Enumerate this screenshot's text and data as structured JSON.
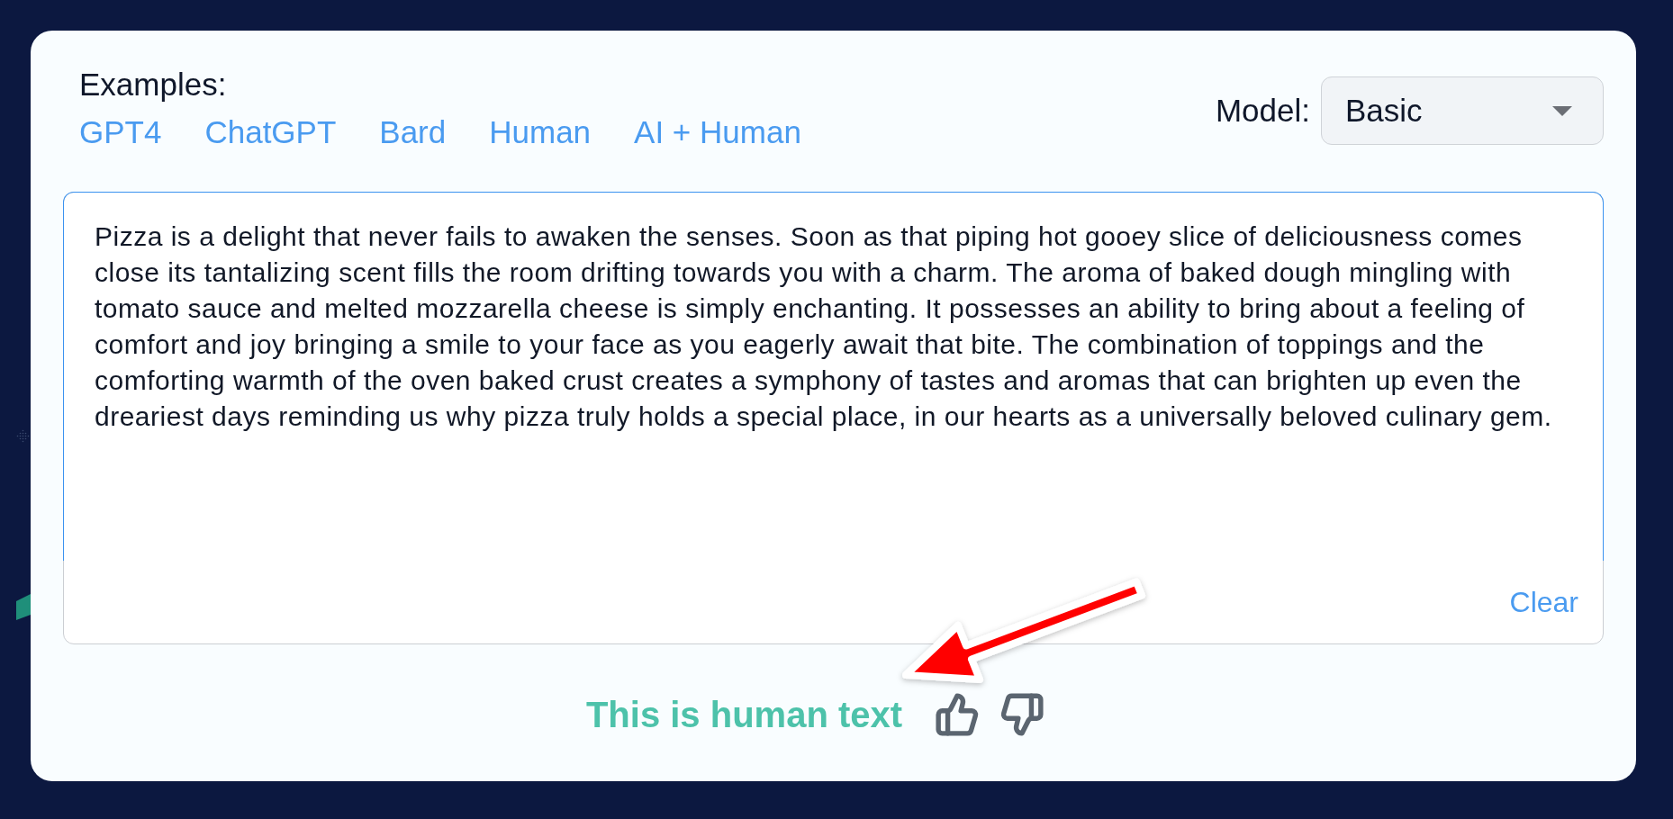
{
  "examples": {
    "label": "Examples:",
    "links": [
      "GPT4",
      "ChatGPT",
      "Bard",
      "Human",
      "AI + Human"
    ]
  },
  "model_select": {
    "label": "Model:",
    "value": "Basic"
  },
  "text_input": {
    "value": "Pizza is a delight that never fails to awaken the senses. Soon as that piping hot gooey slice of deliciousness comes close its tantalizing scent fills the room drifting towards you with a charm. The aroma of baked dough mingling with tomato sauce and melted mozzarella cheese is simply enchanting. It possesses an ability to bring about a feeling of comfort and joy bringing a smile to your face as you eagerly await that bite. The combination of toppings and the comforting warmth of the oven baked crust creates a symphony of tastes and aromas that can brighten up even the dreariest days reminding us why pizza truly holds a special place, in our hearts as a universally beloved culinary gem.",
    "focused": true
  },
  "clear_button": {
    "label": "Clear"
  },
  "result": {
    "text": "This is human text"
  }
}
